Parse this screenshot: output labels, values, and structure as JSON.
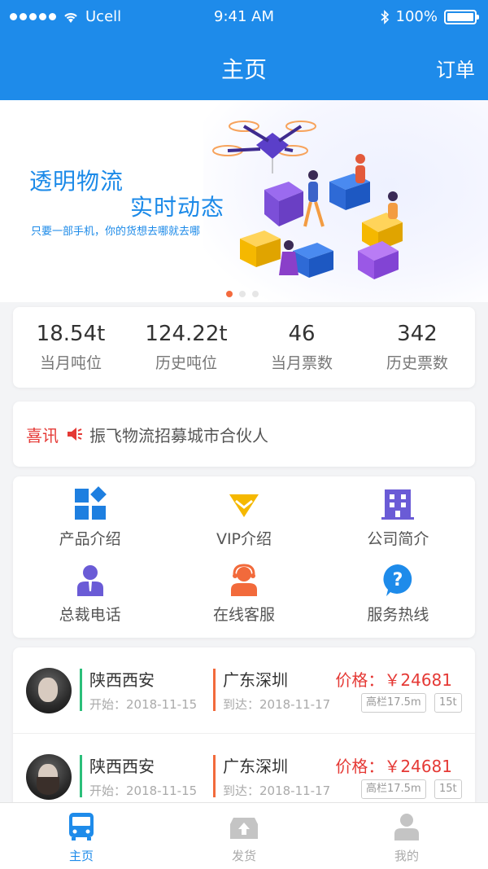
{
  "status_bar": {
    "carrier": "Ucell",
    "time": "9:41 AM",
    "battery": "100%"
  },
  "nav": {
    "title": "主页",
    "right_action": "订单"
  },
  "banner": {
    "line1": "透明物流",
    "line2": "实时动态",
    "line3": "只要一部手机，你的货想去哪就去哪",
    "active_dot": 0,
    "dot_count": 3
  },
  "stats": [
    {
      "value": "18.54t",
      "label": "当月吨位"
    },
    {
      "value": "124.22t",
      "label": "历史吨位"
    },
    {
      "value": "46",
      "label": "当月票数"
    },
    {
      "value": "342",
      "label": "历史票数"
    }
  ],
  "notice": {
    "tag": "喜讯",
    "text": "振飞物流招募城市合伙人"
  },
  "menu": [
    {
      "label": "产品介绍",
      "icon": "grid-diamond-icon",
      "color": "#1e7fe0"
    },
    {
      "label": "VIP介绍",
      "icon": "diamond-icon",
      "color": "#f5b800"
    },
    {
      "label": "公司简介",
      "icon": "building-icon",
      "color": "#6a5bd6"
    },
    {
      "label": "总裁电话",
      "icon": "person-suit-icon",
      "color": "#6a5bd6"
    },
    {
      "label": "在线客服",
      "icon": "headset-agent-icon",
      "color": "#f26a3b"
    },
    {
      "label": "服务热线",
      "icon": "question-bubble-icon",
      "color": "#1e8bea"
    }
  ],
  "orders": [
    {
      "from": "陕西西安",
      "start": "开始：2018-11-15",
      "to": "广东深圳",
      "arrive": "到达：2018-11-17",
      "price": "价格：￥24681",
      "tag1": "高栏17.5m",
      "tag2": "15t"
    },
    {
      "from": "陕西西安",
      "start": "开始：2018-11-15",
      "to": "广东深圳",
      "arrive": "到达：2018-11-17",
      "price": "价格：￥24681",
      "tag1": "高栏17.5m",
      "tag2": "15t"
    }
  ],
  "tabs": [
    {
      "label": "主页",
      "icon": "bus-icon",
      "active": true
    },
    {
      "label": "发货",
      "icon": "upload-box-icon",
      "active": false
    },
    {
      "label": "我的",
      "icon": "user-icon",
      "active": false
    }
  ],
  "colors": {
    "primary": "#1e8bea",
    "alert": "#e53935",
    "green": "#2bbf7a",
    "orange": "#f26a3b"
  }
}
